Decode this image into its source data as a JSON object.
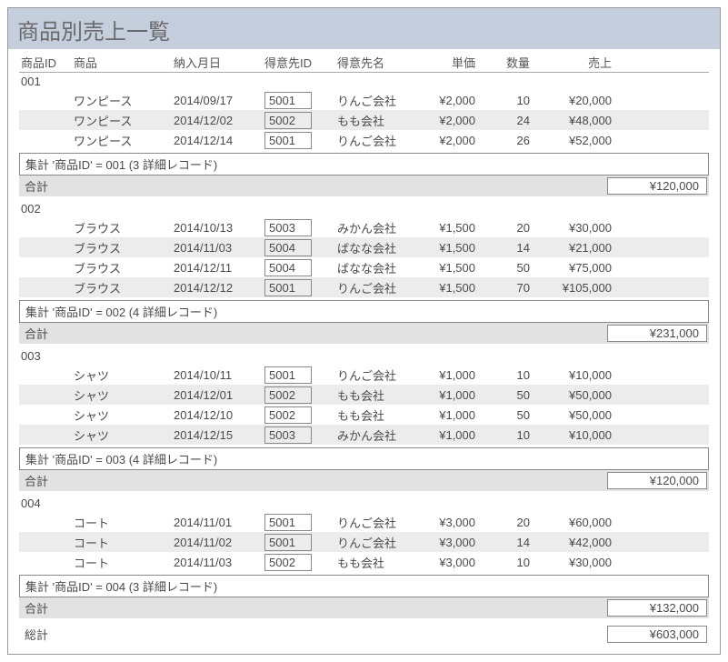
{
  "title": "商品別売上一覧",
  "columns": {
    "product_id": "商品ID",
    "product": "商品",
    "delivery_date": "納入月日",
    "customer_id": "得意先ID",
    "customer_name": "得意先名",
    "unit_price": "単価",
    "quantity": "数量",
    "sales": "売上"
  },
  "labels": {
    "subtotal_prefix": "集計 '商品ID' = ",
    "subtotal_suffix_3": " (3 詳細レコード)",
    "subtotal_suffix_4": " (4 詳細レコード)",
    "gokei": "合計",
    "sokei": "総計"
  },
  "groups": [
    {
      "id": "001",
      "rows": [
        {
          "product": "ワンピース",
          "date": "2014/09/17",
          "custId": "5001",
          "custName": "りんご会社",
          "price": "¥2,000",
          "qty": "10",
          "sales": "¥20,000",
          "alt": false
        },
        {
          "product": "ワンピース",
          "date": "2014/12/02",
          "custId": "5002",
          "custName": "もも会社",
          "price": "¥2,000",
          "qty": "24",
          "sales": "¥48,000",
          "alt": true
        },
        {
          "product": "ワンピース",
          "date": "2014/12/14",
          "custId": "5001",
          "custName": "りんご会社",
          "price": "¥2,000",
          "qty": "26",
          "sales": "¥52,000",
          "alt": false
        }
      ],
      "summary": "集計 '商品ID' = 001 (3 詳細レコード)",
      "total": "¥120,000"
    },
    {
      "id": "002",
      "rows": [
        {
          "product": "ブラウス",
          "date": "2014/10/13",
          "custId": "5003",
          "custName": "みかん会社",
          "price": "¥1,500",
          "qty": "20",
          "sales": "¥30,000",
          "alt": false
        },
        {
          "product": "ブラウス",
          "date": "2014/11/03",
          "custId": "5004",
          "custName": "ばなな会社",
          "price": "¥1,500",
          "qty": "14",
          "sales": "¥21,000",
          "alt": true
        },
        {
          "product": "ブラウス",
          "date": "2014/12/11",
          "custId": "5004",
          "custName": "ばなな会社",
          "price": "¥1,500",
          "qty": "50",
          "sales": "¥75,000",
          "alt": false
        },
        {
          "product": "ブラウス",
          "date": "2014/12/12",
          "custId": "5001",
          "custName": "りんご会社",
          "price": "¥1,500",
          "qty": "70",
          "sales": "¥105,000",
          "alt": true
        }
      ],
      "summary": "集計 '商品ID' = 002 (4 詳細レコード)",
      "total": "¥231,000"
    },
    {
      "id": "003",
      "rows": [
        {
          "product": "シャツ",
          "date": "2014/10/11",
          "custId": "5001",
          "custName": "りんご会社",
          "price": "¥1,000",
          "qty": "10",
          "sales": "¥10,000",
          "alt": false
        },
        {
          "product": "シャツ",
          "date": "2014/12/01",
          "custId": "5002",
          "custName": "もも会社",
          "price": "¥1,000",
          "qty": "50",
          "sales": "¥50,000",
          "alt": true
        },
        {
          "product": "シャツ",
          "date": "2014/12/10",
          "custId": "5002",
          "custName": "もも会社",
          "price": "¥1,000",
          "qty": "50",
          "sales": "¥50,000",
          "alt": false
        },
        {
          "product": "シャツ",
          "date": "2014/12/15",
          "custId": "5003",
          "custName": "みかん会社",
          "price": "¥1,000",
          "qty": "10",
          "sales": "¥10,000",
          "alt": true
        }
      ],
      "summary": "集計 '商品ID' = 003 (4 詳細レコード)",
      "total": "¥120,000"
    },
    {
      "id": "004",
      "rows": [
        {
          "product": "コート",
          "date": "2014/11/01",
          "custId": "5001",
          "custName": "りんご会社",
          "price": "¥3,000",
          "qty": "20",
          "sales": "¥60,000",
          "alt": false
        },
        {
          "product": "コート",
          "date": "2014/11/02",
          "custId": "5001",
          "custName": "りんご会社",
          "price": "¥3,000",
          "qty": "14",
          "sales": "¥42,000",
          "alt": true
        },
        {
          "product": "コート",
          "date": "2014/11/03",
          "custId": "5002",
          "custName": "もも会社",
          "price": "¥3,000",
          "qty": "10",
          "sales": "¥30,000",
          "alt": false
        }
      ],
      "summary": "集計 '商品ID' = 004 (3 詳細レコード)",
      "total": "¥132,000"
    }
  ],
  "grand_total": "¥603,000"
}
